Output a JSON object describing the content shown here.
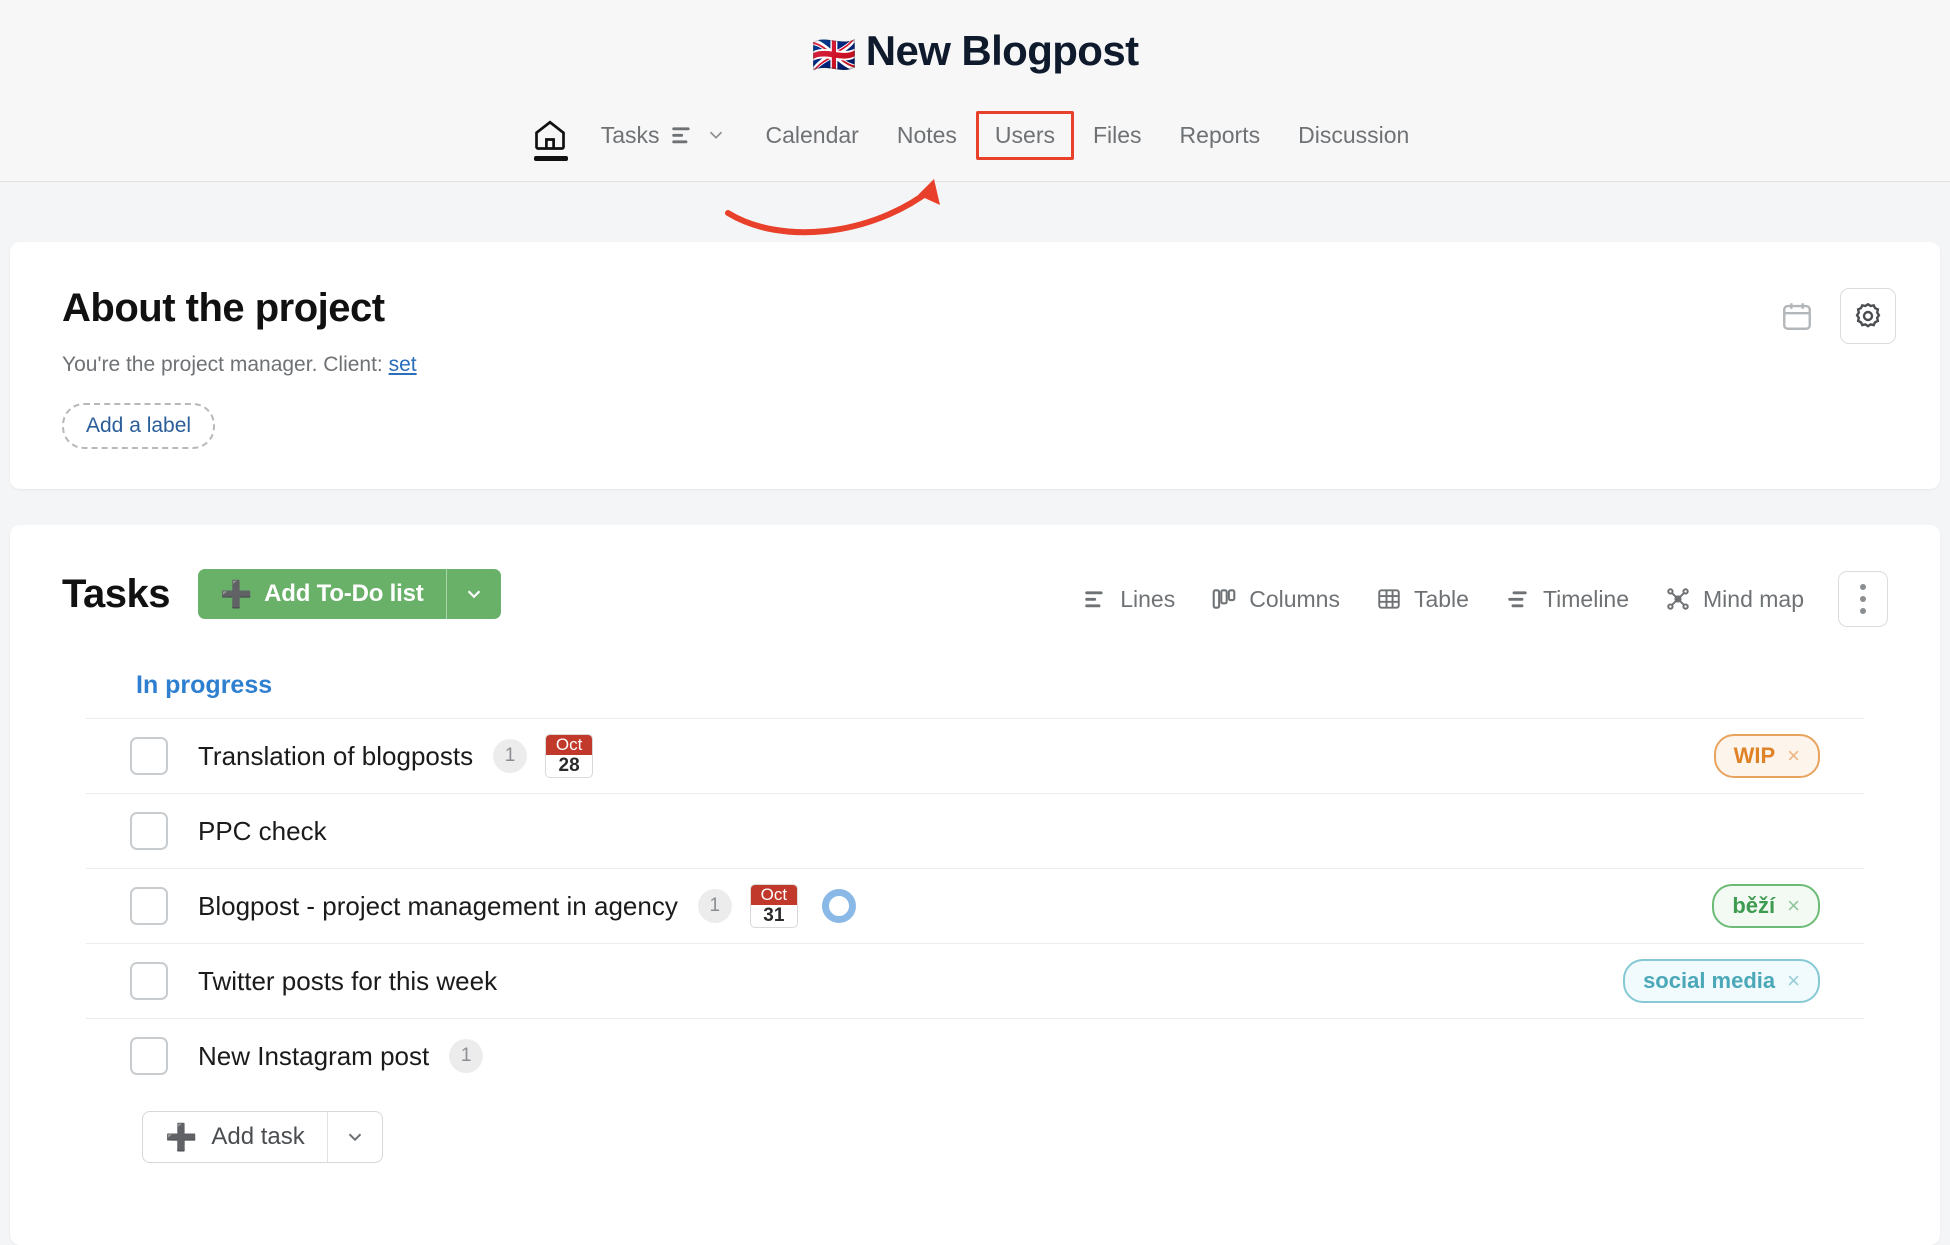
{
  "header": {
    "flag": "🇬🇧",
    "title": "New Blogpost",
    "nav": {
      "home_icon": "home-icon",
      "items": [
        {
          "label": "Tasks",
          "icon": "list-lines-icon",
          "has_chevron": true,
          "highlighted": false
        },
        {
          "label": "Calendar",
          "highlighted": false
        },
        {
          "label": "Notes",
          "highlighted": false
        },
        {
          "label": "Users",
          "highlighted": true
        },
        {
          "label": "Files",
          "highlighted": false
        },
        {
          "label": "Reports",
          "highlighted": false
        },
        {
          "label": "Discussion",
          "highlighted": false
        }
      ]
    }
  },
  "annotation": {
    "highlight_color": "#e8402a",
    "target": "Users"
  },
  "about": {
    "title": "About the project",
    "subtitle_prefix": "You're the project manager. Client: ",
    "subtitle_link": "set",
    "add_label": "Add a label",
    "calendar_icon": "calendar-icon",
    "settings_icon": "gear-icon"
  },
  "tasks": {
    "title": "Tasks",
    "add_todo_label": "Add To-Do list",
    "add_task_label": "Add task",
    "green": "#69b168",
    "views": [
      {
        "label": "Lines",
        "icon": "lines-icon"
      },
      {
        "label": "Columns",
        "icon": "columns-icon"
      },
      {
        "label": "Table",
        "icon": "table-icon"
      },
      {
        "label": "Timeline",
        "icon": "timeline-icon"
      },
      {
        "label": "Mind map",
        "icon": "mind-map-icon"
      }
    ],
    "kebab_icon": "more-vertical-icon",
    "group_title": "In progress",
    "rows": [
      {
        "name": "Translation of blogposts",
        "count": "1",
        "date_month": "Oct",
        "date_day": "28",
        "has_ring": false,
        "tag": {
          "text": "WIP",
          "close": "×",
          "color": "#e08227",
          "bg": "#fdf4ec"
        }
      },
      {
        "name": "PPC check",
        "count": "",
        "date_month": "",
        "date_day": "",
        "has_ring": false,
        "tag": null
      },
      {
        "name": "Blogpost - project management in agency",
        "count": "1",
        "date_month": "Oct",
        "date_day": "31",
        "has_ring": true,
        "tag": {
          "text": "běží",
          "close": "×",
          "color": "#3f9b4f",
          "bg": "#f2faf3"
        }
      },
      {
        "name": "Twitter posts for this week",
        "count": "",
        "date_month": "",
        "date_day": "",
        "has_ring": false,
        "tag": {
          "text": "social media",
          "close": "×",
          "color": "#4aa8b8",
          "bg": "#f1fafc"
        }
      },
      {
        "name": "New Instagram post",
        "count": "1",
        "date_month": "",
        "date_day": "",
        "has_ring": false,
        "tag": null
      }
    ]
  }
}
